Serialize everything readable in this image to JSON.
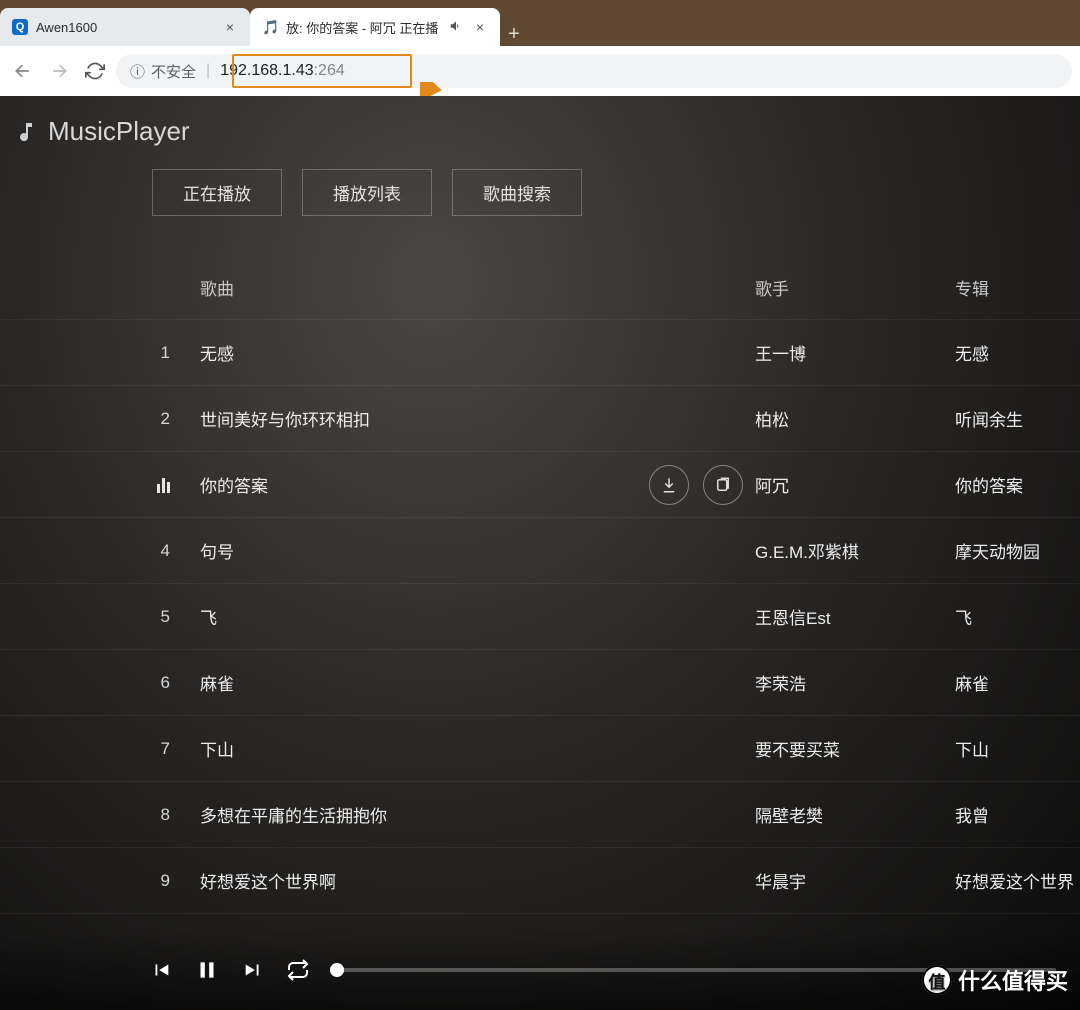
{
  "browser": {
    "tabs": [
      {
        "title": "Awen1600",
        "active": false
      },
      {
        "title": "放: 你的答案 - 阿冗 正在播",
        "active": true,
        "audio": true
      }
    ],
    "newtab_glyph": "+",
    "nav": {
      "back": "←",
      "forward": "→",
      "reload": "↻"
    },
    "security_icon": "ⓘ",
    "security_label": "不安全",
    "separator": "|",
    "url_host": "192.168.1.43",
    "url_port": ":264"
  },
  "app": {
    "title": "MusicPlayer",
    "nav": {
      "now": "正在播放",
      "list": "播放列表",
      "search": "歌曲搜索"
    },
    "columns": {
      "song": "歌曲",
      "artist": "歌手",
      "album": "专辑"
    },
    "tracks": [
      {
        "n": "1",
        "song": "无感",
        "artist": "王一博",
        "album": "无感",
        "playing": false
      },
      {
        "n": "2",
        "song": "世间美好与你环环相扣",
        "artist": "柏松",
        "album": "听闻余生",
        "playing": false
      },
      {
        "n": "",
        "song": "你的答案",
        "artist": "阿冗",
        "album": "你的答案",
        "playing": true
      },
      {
        "n": "4",
        "song": "句号",
        "artist": "G.E.M.邓紫棋",
        "album": "摩天动物园",
        "playing": false
      },
      {
        "n": "5",
        "song": "飞",
        "artist": "王恩信Est",
        "album": "飞",
        "playing": false
      },
      {
        "n": "6",
        "song": "麻雀",
        "artist": "李荣浩",
        "album": "麻雀",
        "playing": false
      },
      {
        "n": "7",
        "song": "下山",
        "artist": "要不要买菜",
        "album": "下山",
        "playing": false
      },
      {
        "n": "8",
        "song": "多想在平庸的生活拥抱你",
        "artist": "隔壁老樊",
        "album": "我曾",
        "playing": false
      },
      {
        "n": "9",
        "song": "好想爱这个世界啊",
        "artist": "华晨宇",
        "album": "好想爱这个世界",
        "playing": false
      }
    ]
  },
  "watermark": {
    "badge": "值",
    "text": "什么值得买"
  }
}
